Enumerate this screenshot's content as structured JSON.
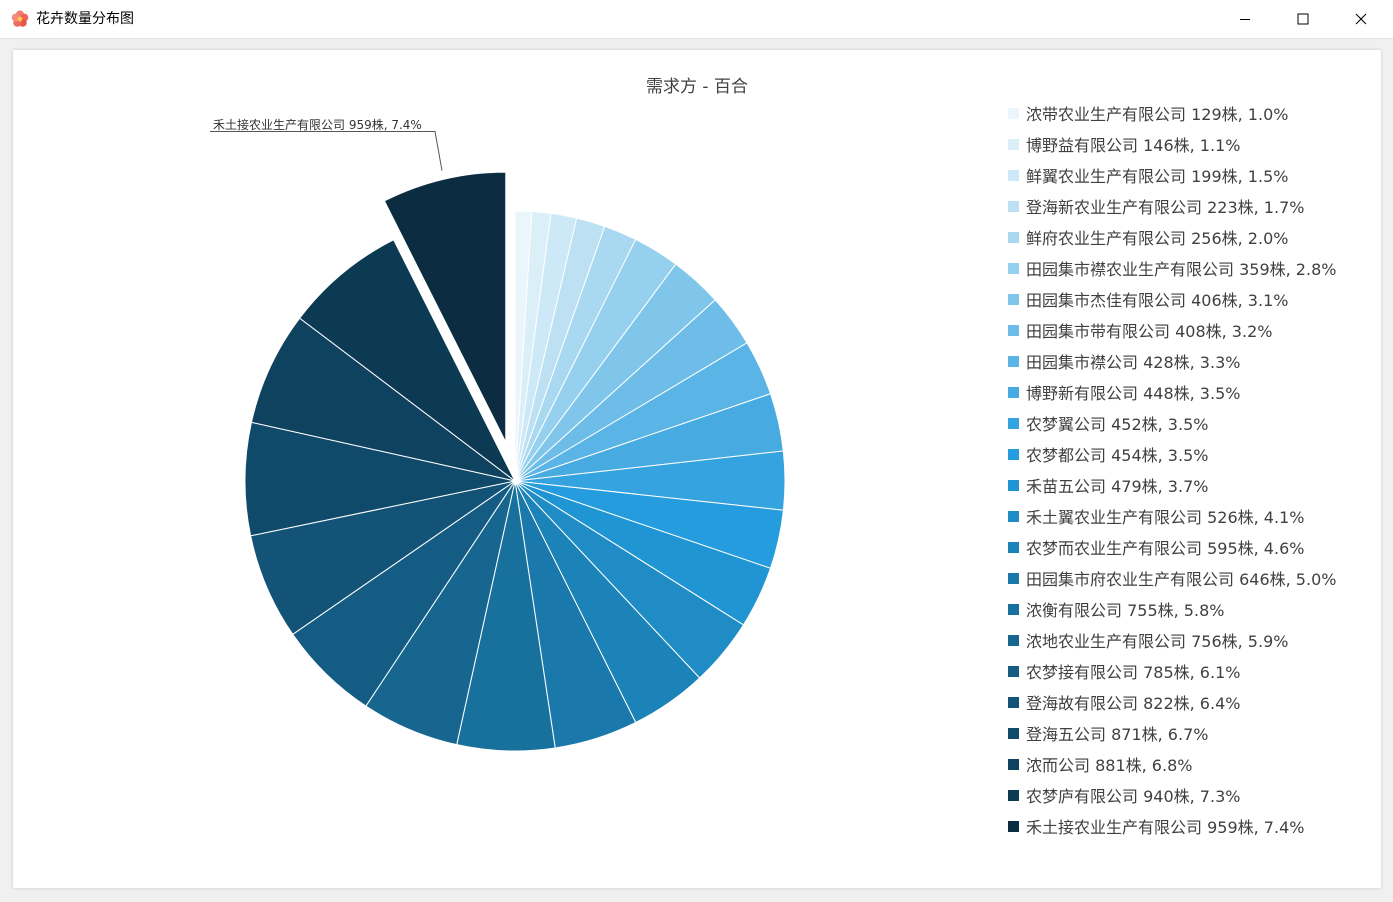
{
  "window": {
    "title": "花卉数量分布图"
  },
  "chart_data": {
    "type": "pie",
    "title": "需求方 - 百合",
    "unit": "株",
    "exploded_slice": "禾土接农业生产有限公司",
    "callout_label": "禾土接农业生产有限公司 959株, 7.4%",
    "legend_position": "right",
    "slices": [
      {
        "label": "浓带农业生产有限公司",
        "value": 129,
        "percent": "1.0%",
        "color": "#eaf6fb",
        "legend": "浓带农业生产有限公司 129株, 1.0%"
      },
      {
        "label": "博野益有限公司",
        "value": 146,
        "percent": "1.1%",
        "color": "#dbeff9",
        "legend": "博野益有限公司 146株, 1.1%"
      },
      {
        "label": "鲜翼农业生产有限公司",
        "value": 199,
        "percent": "1.5%",
        "color": "#cde8f6",
        "legend": "鲜翼农业生产有限公司 199株, 1.5%"
      },
      {
        "label": "登海新农业生产有限公司",
        "value": 223,
        "percent": "1.7%",
        "color": "#bde1f3",
        "legend": "登海新农业生产有限公司 223株, 1.7%"
      },
      {
        "label": "鲜府农业生产有限公司",
        "value": 256,
        "percent": "2.0%",
        "color": "#a9d8f1",
        "legend": "鲜府农业生产有限公司 256株, 2.0%"
      },
      {
        "label": "田园集市襟农业生产有限公司",
        "value": 359,
        "percent": "2.8%",
        "color": "#95d0ee",
        "legend": "田园集市襟农业生产有限公司 359株, 2.8%"
      },
      {
        "label": "田园集市杰佳有限公司",
        "value": 406,
        "percent": "3.1%",
        "color": "#80c6eb",
        "legend": "田园集市杰佳有限公司 406株, 3.1%"
      },
      {
        "label": "田园集市带有限公司",
        "value": 408,
        "percent": "3.2%",
        "color": "#6dbde8",
        "legend": "田园集市带有限公司 408株, 3.2%"
      },
      {
        "label": "田园集市襟公司",
        "value": 428,
        "percent": "3.3%",
        "color": "#5ab4e5",
        "legend": "田园集市襟公司 428株, 3.3%"
      },
      {
        "label": "博野新有限公司",
        "value": 448,
        "percent": "3.5%",
        "color": "#47abe2",
        "legend": "博野新有限公司 448株, 3.5%"
      },
      {
        "label": "农梦翼公司",
        "value": 452,
        "percent": "3.5%",
        "color": "#35a3e0",
        "legend": "农梦翼公司 452株, 3.5%"
      },
      {
        "label": "农梦都公司",
        "value": 454,
        "percent": "3.5%",
        "color": "#249cde",
        "legend": "农梦都公司 454株, 3.5%"
      },
      {
        "label": "禾苗五公司",
        "value": 479,
        "percent": "3.7%",
        "color": "#2095d3",
        "legend": "禾苗五公司 479株, 3.7%"
      },
      {
        "label": "禾土翼农业生产有限公司",
        "value": 526,
        "percent": "4.1%",
        "color": "#1f8cc6",
        "legend": "禾土翼农业生产有限公司 526株, 4.1%"
      },
      {
        "label": "农梦而农业生产有限公司",
        "value": 595,
        "percent": "4.6%",
        "color": "#1c83b8",
        "legend": "农梦而农业生产有限公司 595株, 4.6%"
      },
      {
        "label": "田园集市府农业生产有限公司",
        "value": 646,
        "percent": "5.0%",
        "color": "#1a79aa",
        "legend": "田园集市府农业生产有限公司 646株, 5.0%"
      },
      {
        "label": "浓衡有限公司",
        "value": 755,
        "percent": "5.8%",
        "color": "#18709d",
        "legend": "浓衡有限公司 755株, 5.8%"
      },
      {
        "label": "浓地农业生产有限公司",
        "value": 756,
        "percent": "5.9%",
        "color": "#166690",
        "legend": "浓地农业生产有限公司 756株, 5.9%"
      },
      {
        "label": "农梦接有限公司",
        "value": 785,
        "percent": "6.1%",
        "color": "#145c83",
        "legend": "农梦接有限公司 785株, 6.1%"
      },
      {
        "label": "登海故有限公司",
        "value": 822,
        "percent": "6.4%",
        "color": "#125377",
        "legend": "登海故有限公司 822株, 6.4%"
      },
      {
        "label": "登海五公司",
        "value": 871,
        "percent": "6.7%",
        "color": "#104a6a",
        "legend": "登海五公司 871株, 6.7%"
      },
      {
        "label": "浓而公司",
        "value": 881,
        "percent": "6.8%",
        "color": "#0f425f",
        "legend": "浓而公司 881株, 6.8%"
      },
      {
        "label": "农梦庐有限公司",
        "value": 940,
        "percent": "7.3%",
        "color": "#0d3a53",
        "legend": "农梦庐有限公司 940株, 7.3%"
      },
      {
        "label": "禾土接农业生产有限公司",
        "value": 959,
        "percent": "7.4%",
        "color": "#0b2c41",
        "legend": "禾土接农业生产有限公司 959株, 7.4%"
      }
    ]
  }
}
